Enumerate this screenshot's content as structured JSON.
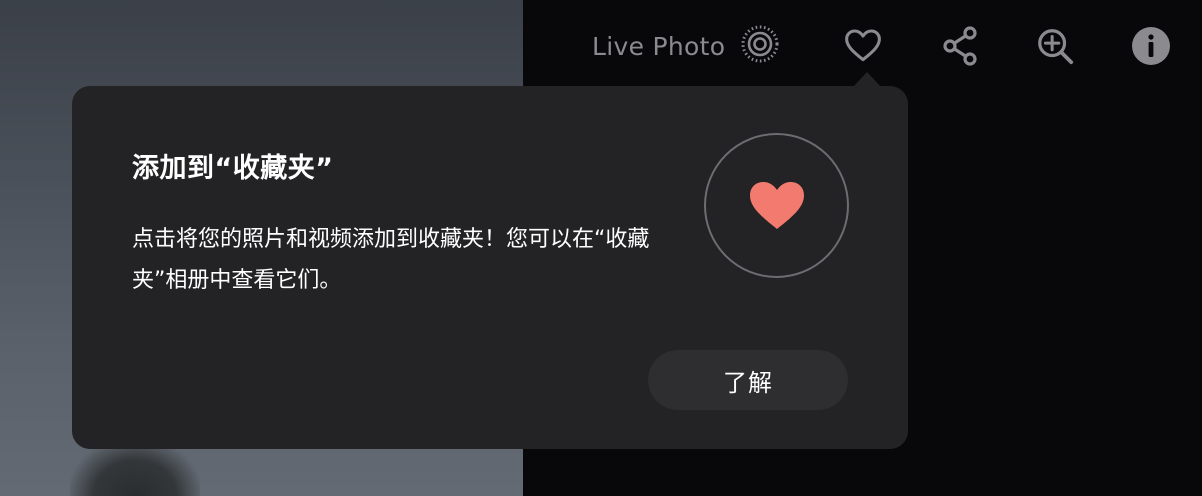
{
  "toolbar": {
    "live_photo_label": "Live Photo",
    "icons": [
      "live-photo-icon",
      "heart-icon",
      "share-icon",
      "zoom-in-icon",
      "info-icon"
    ]
  },
  "popover": {
    "title": "添加到“收藏夹”",
    "body": "点击将您的照片和视频添加到收藏夹！您可以在“收藏夹”相册中查看它们。",
    "button_label": "了解",
    "icon": "heart-icon"
  },
  "colors": {
    "heart_accent": "#f27a6e",
    "popover_bg": "#232224",
    "icon_gray": "#8a8a8f"
  }
}
